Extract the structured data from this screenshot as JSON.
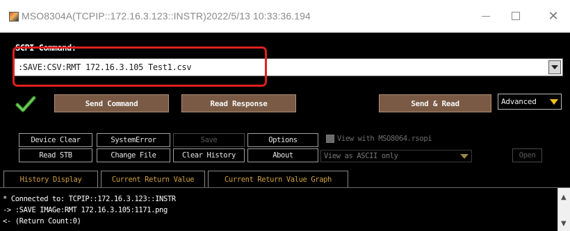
{
  "window": {
    "title": "MSO8304A(TCPIP::172.16.3.123::INSTR)2022/5/13 10:33:36.194",
    "minimize_glyph": "",
    "maximize_glyph": "",
    "close_glyph": "✕"
  },
  "command": {
    "label": "SCPI Command:",
    "value": ":SAVE:CSV:RMT 172.16.3.105 Test1.csv"
  },
  "actions": {
    "send_command": "Send Command",
    "read_response": "Read Response",
    "send_and_read": "Send & Read",
    "mode_selected": "Advanced"
  },
  "tools": {
    "device_clear": "Device Clear",
    "system_error": "SystemError",
    "save": "Save",
    "options": "Options",
    "read_stb": "Read STB",
    "change_file": "Change File",
    "clear_history": "Clear History",
    "about": "About",
    "open": "Open"
  },
  "options": {
    "view_with_rsopi": "View with MSO8064.rsopi",
    "view_mode_selected": "View as ASCII only"
  },
  "tabs": [
    {
      "label": "History Display"
    },
    {
      "label": "Current Return Value"
    },
    {
      "label": "Current Return Value Graph"
    }
  ],
  "history": [
    "* Connected to: TCPIP::172.16.3.123::INSTR",
    "-> :SAVE IMAGe:RMT 172.16.3.105:1171.png",
    "<- (Return Count:0)"
  ],
  "colors": {
    "accent_button": "#7a5a44",
    "tab_text": "#d0a040",
    "highlight_frame": "#e02020",
    "check_icon": "#3fa030"
  },
  "icons": {
    "app": "app-icon",
    "check": "check-icon",
    "dropdown": "chevron-down-icon"
  }
}
